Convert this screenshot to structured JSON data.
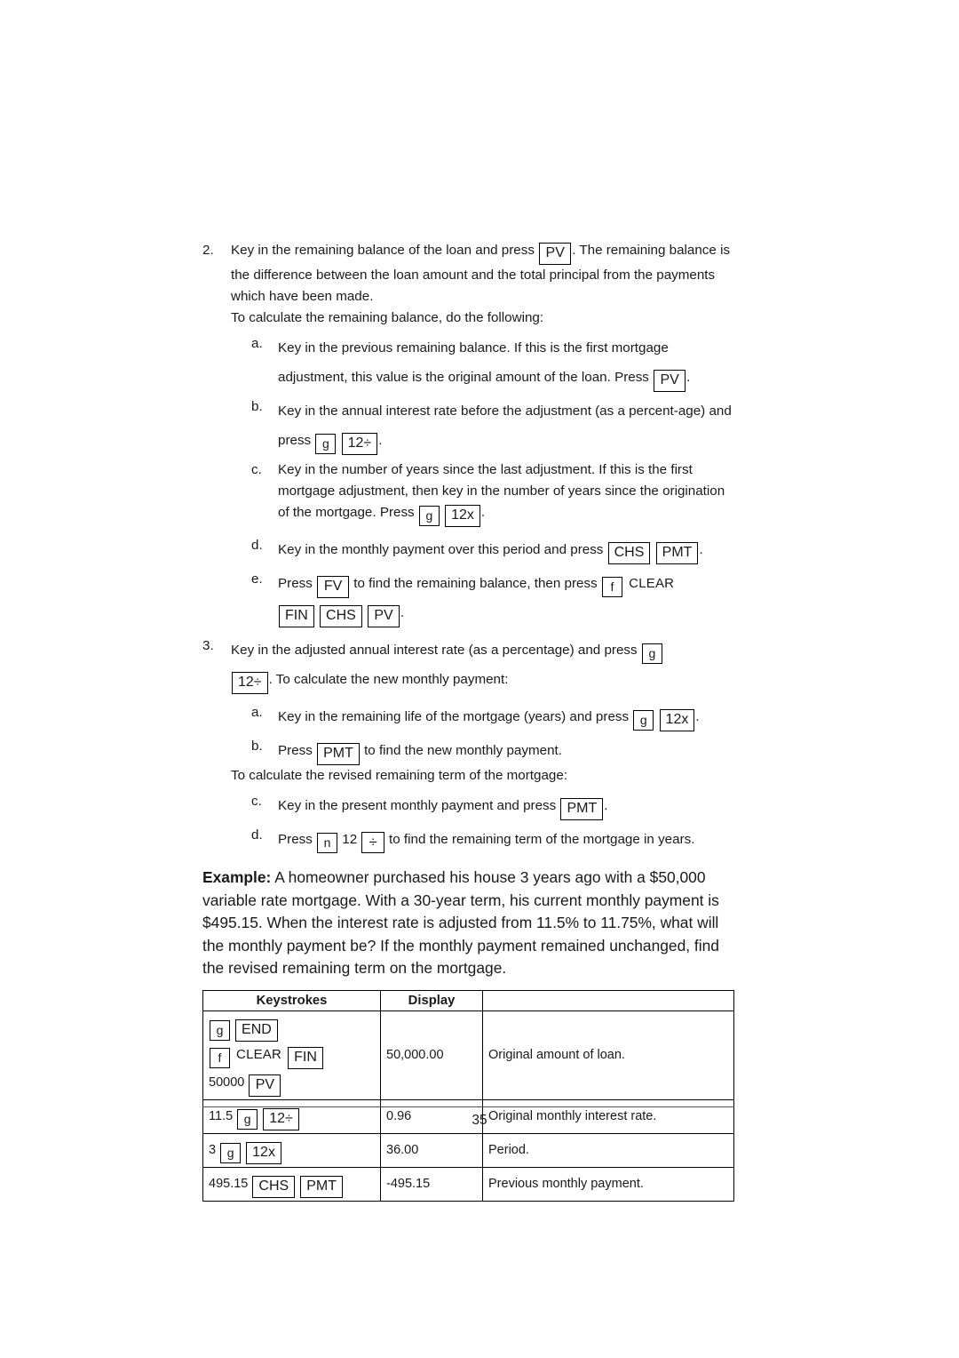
{
  "page": {
    "number": "35"
  },
  "steps": [
    {
      "num": "2.",
      "text_1": "Key in the remaining balance of the loan and press",
      "key_1": "PV",
      "text_2": ". The remaining balance is the difference between the loan amount and the total principal from the payments which have been made.",
      "text_3": "To calculate the remaining balance, do the following:",
      "subs": [
        {
          "num": "a.",
          "text_1": "Key in the previous remaining balance. If this is the first mortgage adjustment, this value is the original amount of the loan. Press",
          "key_1": "PV",
          "text_2": "."
        },
        {
          "num": "b.",
          "text_1": "Key in the annual interest rate before the adjustment (as a percent-age) and press",
          "key_1": "g",
          "key_2": "12÷",
          "text_2": "."
        },
        {
          "num": "c.",
          "text_1": "Key in the number of years since the last adjustment. If this is the first mortgage adjustment, then key in the number of years since the origination of the mortgage. Press",
          "key_1": "g",
          "key_2": "12x",
          "text_2": "."
        },
        {
          "num": "d.",
          "text_1": "Key in the monthly payment over this period and press",
          "key_1": "CHS",
          "key_2": "PMT",
          "text_2": "."
        },
        {
          "num": "e.",
          "text_1": "Press",
          "key_1": "FV",
          "text_2": "to find the remaining balance, then press",
          "key_2": "f",
          "text_3": "CLEAR",
          "key_3": "FIN",
          "key_4": "CHS",
          "key_5": "PV",
          "text_4": "."
        }
      ]
    },
    {
      "num": "3.",
      "text_1": "Key in the adjusted annual interest rate (as a percentage) and press",
      "key_1": "g",
      "key_2": "12÷",
      "text_2": ". To calculate the new monthly payment:",
      "subs": [
        {
          "num": "a.",
          "text_1": "Key in the remaining life of the mortgage (years) and press",
          "key_1": "g",
          "key_2": "12x",
          "text_2": "."
        },
        {
          "num": "b.",
          "text_1": "Press",
          "key_1": "PMT",
          "text_2": "to find the new monthly payment."
        }
      ],
      "note": "To calculate the revised remaining term of the mortgage:",
      "subs2": [
        {
          "num": "c.",
          "text_1": "Key in the present monthly payment and press",
          "key_1": "PMT",
          "text_2": "."
        },
        {
          "num": "d.",
          "text_1": "Press",
          "key_1": "n",
          "text_2": "12",
          "key_2": "÷",
          "text_3": "to find the remaining term of the mortgage in years."
        }
      ]
    }
  ],
  "example": {
    "lead": "Example:",
    "body": " A homeowner purchased his house 3 years ago with a $50,000 variable rate mortgage. With a 30-year term, his current monthly payment is $495.15. When the interest rate is adjusted from 11.5% to 11.75%, what will the monthly payment be? If the monthly payment remained unchanged, find the revised remaining term on the mortgage."
  },
  "table": {
    "headers": [
      "Keystrokes",
      "Display",
      ""
    ],
    "rows": [
      {
        "keys_line1_a": "g",
        "keys_line1_b": "END",
        "keys_line2_a": "f",
        "keys_line2_text": "CLEAR",
        "keys_line2_b": "FIN",
        "keys_line3_text": "50000",
        "keys_line3_a": "PV",
        "display": "50,000.00",
        "note": "Original amount of loan."
      },
      {
        "pre": "11.5",
        "key_a": "g",
        "key_b": "12÷",
        "display": "0.96",
        "note": "Original monthly interest rate."
      },
      {
        "pre": "3",
        "key_a": "g",
        "key_b": "12x",
        "display": "36.00",
        "note": "Period."
      },
      {
        "pre": "495.15",
        "key_a": "CHS",
        "key_b": "PMT",
        "display": "-495.15",
        "note": "Previous monthly payment."
      }
    ]
  }
}
